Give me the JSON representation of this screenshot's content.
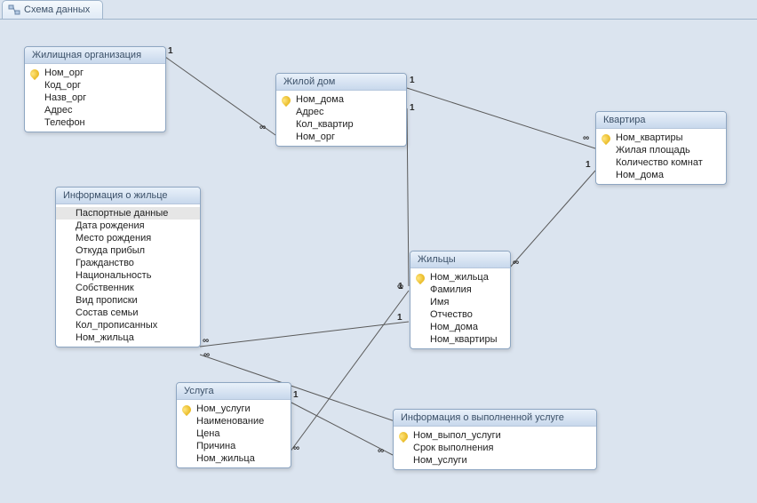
{
  "tab": {
    "title": "Схема данных"
  },
  "entities": {
    "housing_org": {
      "title": "Жилищная организация",
      "fields": [
        "Ном_орг",
        "Код_орг",
        "Назв_орг",
        "Адрес",
        "Телефон"
      ],
      "pk": [
        0
      ]
    },
    "house": {
      "title": "Жилой дом",
      "fields": [
        "Ном_дома",
        "Адрес",
        "Кол_квартир",
        "Ном_орг"
      ],
      "pk": [
        0
      ]
    },
    "apartment": {
      "title": "Квартира",
      "fields": [
        "Ном_квартиры",
        "Жилая площадь",
        "Количество комнат",
        "Ном_дома"
      ],
      "pk": [
        0
      ]
    },
    "resident_info": {
      "title": "Информация о жильце",
      "fields": [
        "Паспортные данные",
        "Дата рождения",
        "Место рождения",
        "Откуда прибыл",
        "Гражданство",
        "Национальность",
        "Собственник",
        "Вид прописки",
        "Состав семьи",
        "Кол_прописанных",
        "Ном_жильца"
      ],
      "pk": [],
      "selected": [
        0
      ]
    },
    "residents": {
      "title": "Жильцы",
      "fields": [
        "Ном_жильца",
        "Фамилия",
        "Имя",
        "Отчество",
        "Ном_дома",
        "Ном_квартиры"
      ],
      "pk": [
        0
      ]
    },
    "service": {
      "title": "Услуга",
      "fields": [
        "Ном_услуги",
        "Наименование",
        "Цена",
        "Причина",
        "Ном_жильца"
      ],
      "pk": [
        0
      ]
    },
    "service_info": {
      "title": "Информация о выполненной услуге",
      "fields": [
        "Ном_выпол_услуги",
        "Срок выполнения",
        "Ном_услуги"
      ],
      "pk": [
        0
      ]
    }
  },
  "cardinality": {
    "one": "1",
    "many": "∞"
  }
}
